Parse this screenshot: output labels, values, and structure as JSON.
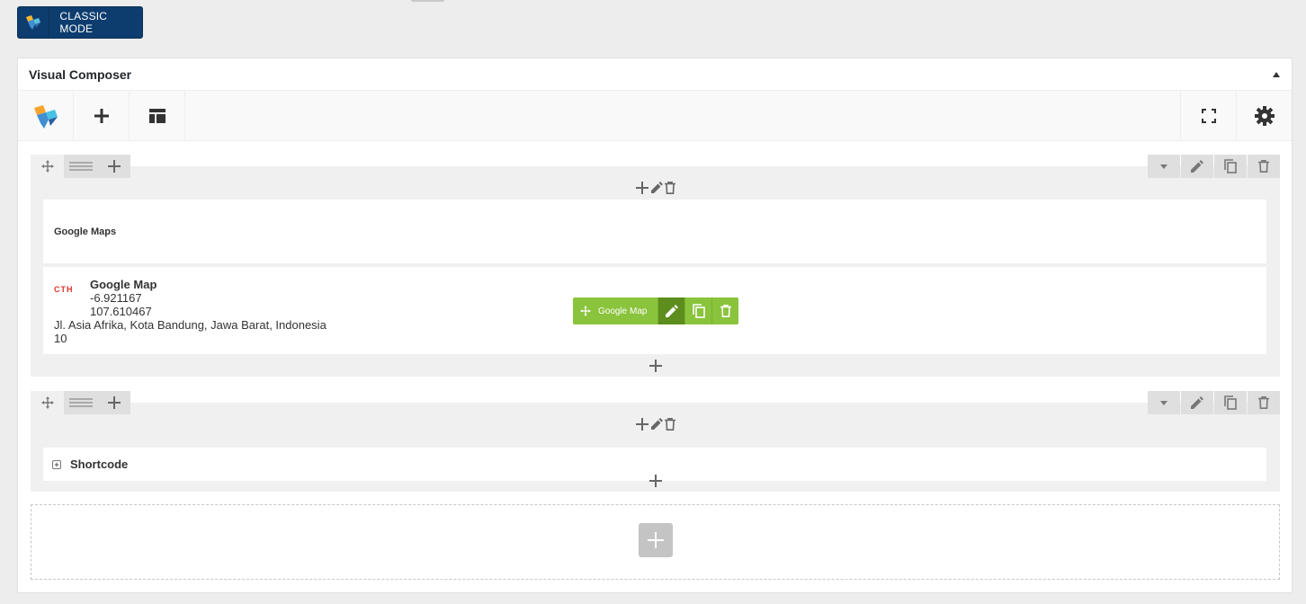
{
  "classic_mode": {
    "label": "CLASSIC MODE"
  },
  "panel": {
    "title": "Visual Composer"
  },
  "toolbar": {
    "items": [
      "vc-logo",
      "add-element",
      "templates"
    ],
    "right": [
      "fullscreen",
      "settings"
    ]
  },
  "rows": [
    {
      "columns": [
        {
          "elements": [
            {
              "type": "text",
              "title": "Google Maps"
            },
            {
              "type": "google-map",
              "name": "Google Map",
              "lat": "-6.921167",
              "lng": "107.610467",
              "address": "Jl. Asia Afrika, Kota Bandung, Jawa Barat, Indonesia",
              "zoom": "10",
              "logo_text": "CTH",
              "hover_label": "Google Map"
            }
          ]
        }
      ]
    },
    {
      "columns": [
        {
          "elements": [
            {
              "type": "shortcode",
              "title": "Shortcode"
            }
          ]
        }
      ]
    }
  ],
  "colors": {
    "classic_bg": "#0d3d6e",
    "accent_green": "#8ac33c",
    "accent_green_dark": "#5d8d1d",
    "logo_red": "#e0342a"
  }
}
